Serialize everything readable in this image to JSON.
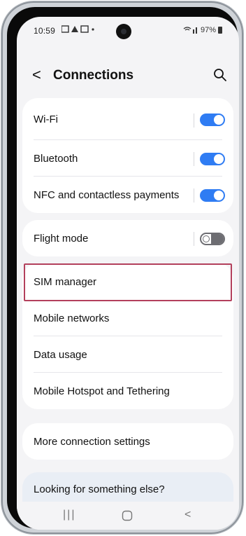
{
  "status_bar": {
    "time": "10:59",
    "notification_icons": "✉ ▲ ✉ •",
    "signal_text": "≈.┃",
    "battery": "97%"
  },
  "header": {
    "back_glyph": "<",
    "title": "Connections",
    "search_icon": "search-icon"
  },
  "card1": [
    {
      "label": "Wi-Fi",
      "toggle": "on"
    },
    {
      "label": "Bluetooth",
      "toggle": "on"
    },
    {
      "label": "NFC and contactless payments",
      "toggle": "on"
    }
  ],
  "card2": [
    {
      "label": "Flight mode",
      "toggle": "off"
    }
  ],
  "card3": [
    {
      "label": "SIM manager"
    },
    {
      "label": "Mobile networks"
    },
    {
      "label": "Data usage"
    },
    {
      "label": "Mobile Hotspot and Tethering"
    }
  ],
  "card4": [
    {
      "label": "More connection settings"
    }
  ],
  "footer": {
    "suggestion": "Looking for something else?"
  },
  "navbar": {
    "recents_glyph": "|||",
    "home_glyph": "▢",
    "back_glyph": "<"
  },
  "colors": {
    "toggle_on": "#2f7cf3",
    "highlight": "#b3405c"
  }
}
